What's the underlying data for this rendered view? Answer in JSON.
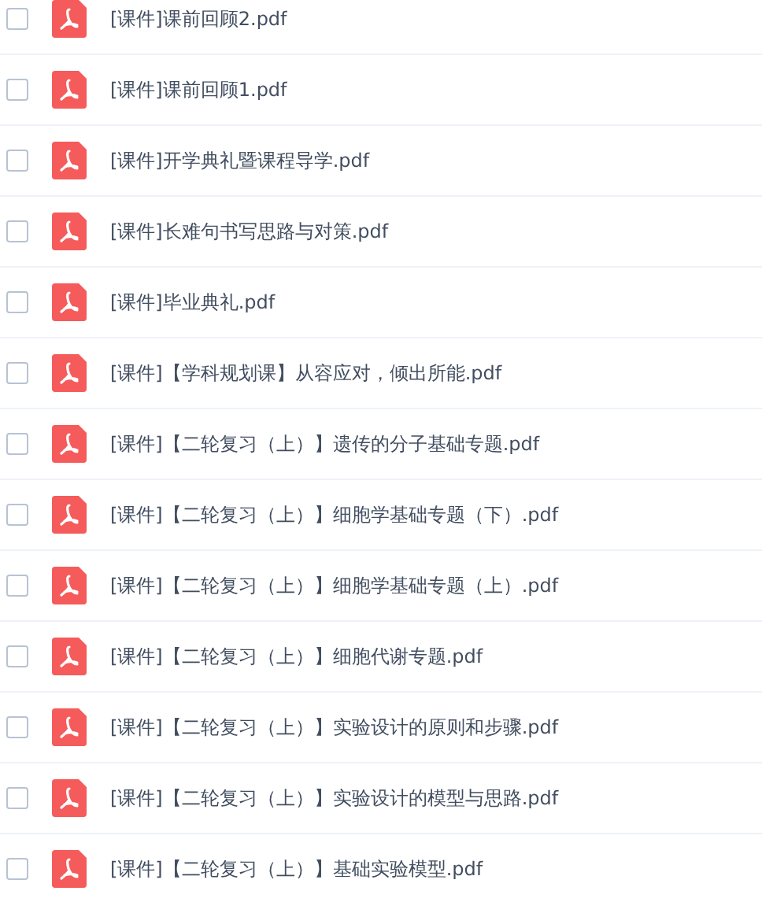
{
  "files": [
    {
      "name": "[课件]课前回顾2.pdf",
      "checked": false
    },
    {
      "name": "[课件]课前回顾1.pdf",
      "checked": false
    },
    {
      "name": "[课件]开学典礼暨课程导学.pdf",
      "checked": false
    },
    {
      "name": "[课件]长难句书写思路与对策.pdf",
      "checked": false
    },
    {
      "name": "[课件]毕业典礼.pdf",
      "checked": false
    },
    {
      "name": "[课件]【学科规划课】从容应对，倾出所能.pdf",
      "checked": false
    },
    {
      "name": "[课件]【二轮复习（上）】遗传的分子基础专题.pdf",
      "checked": false
    },
    {
      "name": "[课件]【二轮复习（上）】细胞学基础专题（下）.pdf",
      "checked": false
    },
    {
      "name": "[课件]【二轮复习（上）】细胞学基础专题（上）.pdf",
      "checked": false
    },
    {
      "name": "[课件]【二轮复习（上）】细胞代谢专题.pdf",
      "checked": false
    },
    {
      "name": "[课件]【二轮复习（上）】实验设计的原则和步骤.pdf",
      "checked": false
    },
    {
      "name": "[课件]【二轮复习（上）】实验设计的模型与思路.pdf",
      "checked": false
    },
    {
      "name": "[课件]【二轮复习（上）】基础实验模型.pdf",
      "checked": false
    }
  ]
}
